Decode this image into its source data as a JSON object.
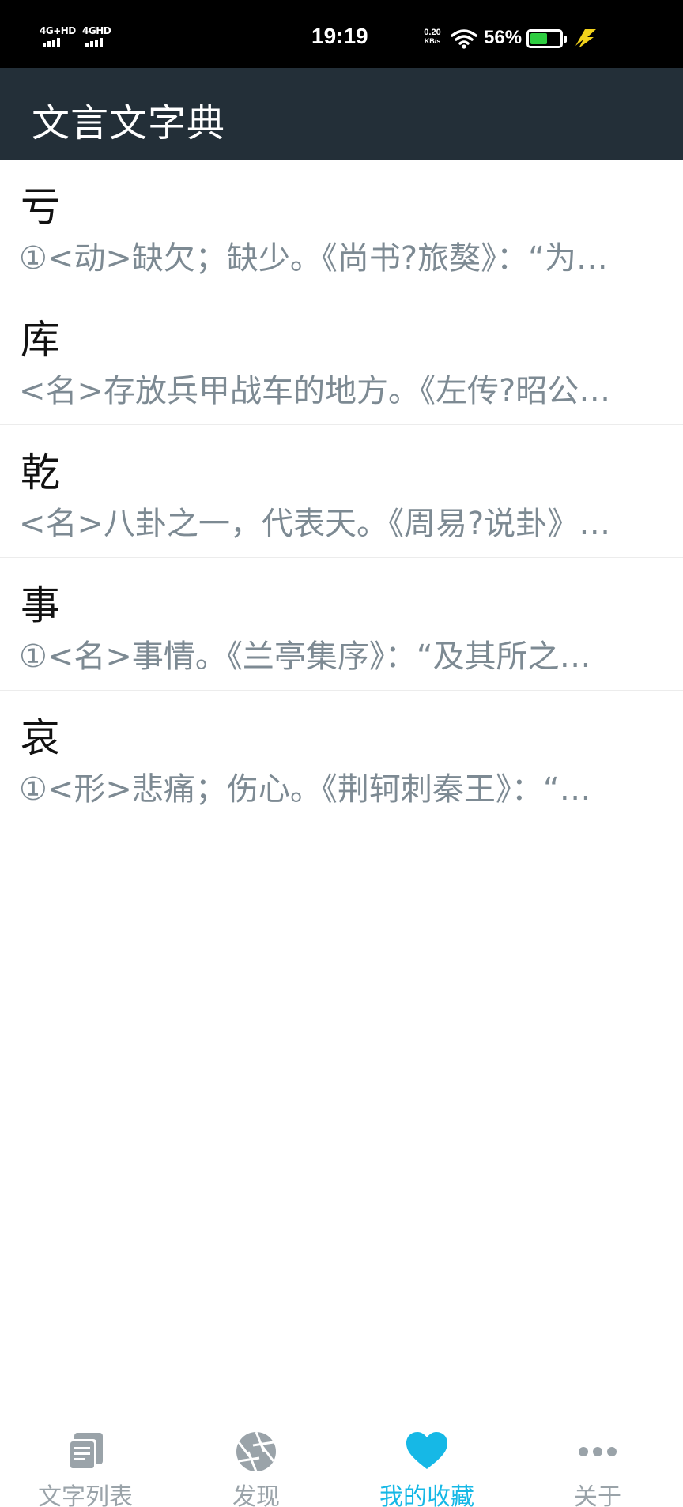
{
  "status_bar": {
    "network_1": "4G+HD",
    "network_2": "4GHD",
    "time": "19:19",
    "speed_value": "0.20",
    "speed_unit": "KB/s",
    "battery_percent": "56%",
    "battery_level": 0.56,
    "battery_color": "#2ecc40",
    "charging_color": "#f2d21b"
  },
  "app_bar": {
    "title": "文言文字典",
    "background": "#232f38"
  },
  "favorites": [
    {
      "char": "亏",
      "definition": "①<动>缺欠；缺少。《尚书?旅獒》：“为…"
    },
    {
      "char": "库",
      "definition": "<名>存放兵甲战车的地方。《左传?昭公…"
    },
    {
      "char": "乾",
      "definition": "<名>八卦之一，代表天。《周易?说卦》…"
    },
    {
      "char": "事",
      "definition": "①<名>事情。《兰亭集序》：“及其所之…"
    },
    {
      "char": "哀",
      "definition": "①<形>悲痛；伤心。《荆轲刺秦王》：“…"
    }
  ],
  "bottom_nav": {
    "active_color": "#16b8e6",
    "inactive_color": "#9aa3a9",
    "items": [
      {
        "label": "文字列表",
        "icon": "list-document-icon",
        "active": false
      },
      {
        "label": "发现",
        "icon": "aperture-icon",
        "active": false
      },
      {
        "label": "我的收藏",
        "icon": "heart-icon",
        "active": true
      },
      {
        "label": "关于",
        "icon": "more-dots-icon",
        "active": false
      }
    ]
  }
}
